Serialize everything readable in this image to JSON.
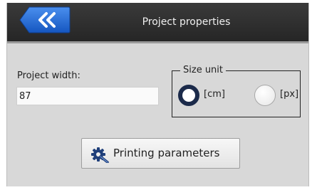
{
  "header": {
    "title": "Project properties",
    "back_icon": "double-chevron-left-icon",
    "accent": "#1f6bd8"
  },
  "form": {
    "width_label": "Project width:",
    "width_value": "87"
  },
  "size_unit": {
    "legend": "Size unit",
    "options": [
      {
        "label": "[cm]",
        "selected": true
      },
      {
        "label": "[px]",
        "selected": false
      }
    ]
  },
  "printing": {
    "button_label": "Printing parameters",
    "icon": "gear-wrench-icon"
  }
}
